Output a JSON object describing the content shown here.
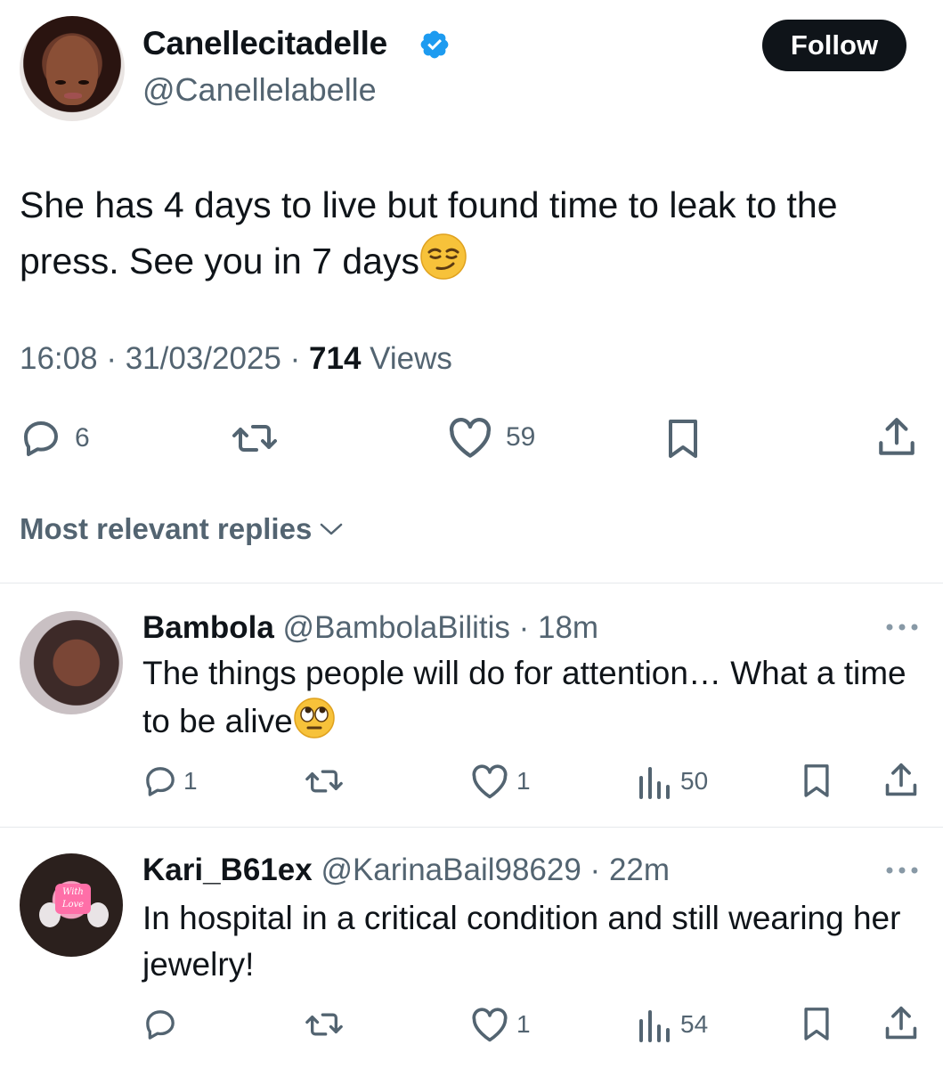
{
  "tweet": {
    "display_name": "Canellecitadelle",
    "handle": "@Canellelabelle",
    "follow_label": "Follow",
    "text": "She has 4 days to live but found time to leak to the press. See you in 7 days",
    "text_emoji": "smirking-face",
    "time": "16:08",
    "date": "31/03/2025",
    "views_count": "714",
    "views_label": "Views",
    "reply_count": "6",
    "like_count": "59"
  },
  "replies_filter": {
    "label": "Most relevant replies"
  },
  "replies": [
    {
      "name": "Bambola",
      "handle": "@BambolaBilitis",
      "age": "18m",
      "text": "The things people will do for attention… What a time to be alive",
      "text_emoji": "face-with-rolling-eyes",
      "reply_count": "1",
      "like_count": "1",
      "views": "50"
    },
    {
      "name": "Kari_B61ex",
      "handle": "@KarinaBail98629",
      "age": "22m",
      "text": "In hospital in a critical condition and still wearing her jewelry!",
      "reply_count": "",
      "like_count": "1",
      "views": "54"
    }
  ],
  "colors": {
    "text_primary": "#0f1419",
    "text_secondary": "#536471",
    "verified_blue": "#1d9bf0",
    "divider": "#e6e9ec"
  }
}
